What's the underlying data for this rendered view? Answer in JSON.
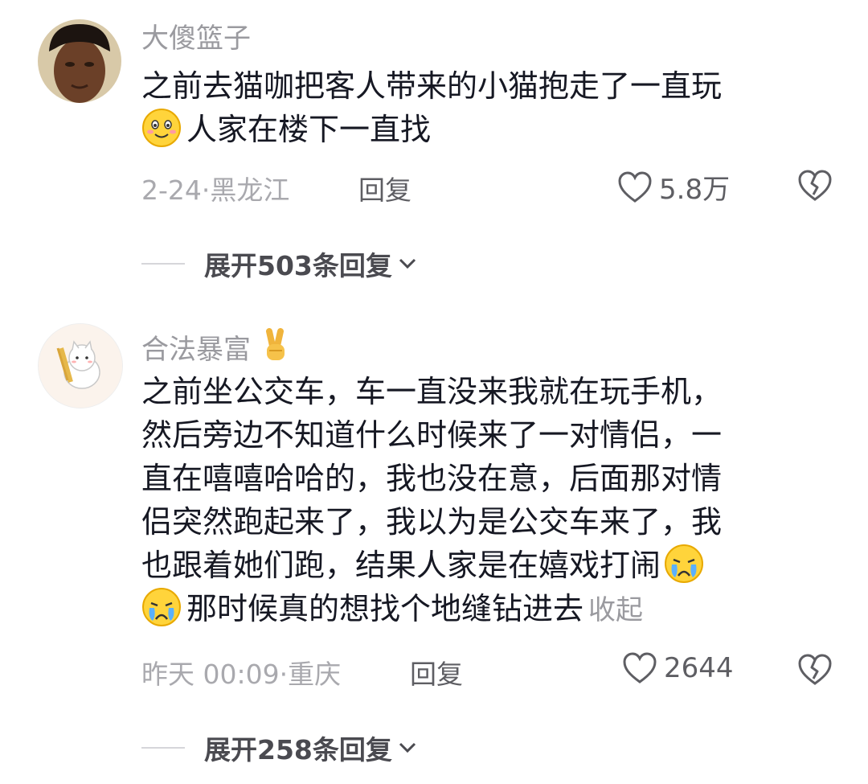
{
  "comments": [
    {
      "username": "大傻篮子",
      "lines": [
        "之前去猫咖把客人带来的小猫抱走了一直玩",
        "人家在楼下一直找"
      ],
      "date_location": "2-24·黑龙江",
      "reply_label": "回复",
      "likes": "5.8万",
      "expand_label": "展开503条回复"
    },
    {
      "username": "合法暴富",
      "username_emoji": "✌️",
      "lines": [
        "之前坐公交车，车一直没来我就在玩手机，",
        "然后旁边不知道什么时候来了一对情侣，一",
        "直在嘻嘻哈哈的，我也没在意，后面那对情",
        "侣突然跑起来了，我以为是公交车来了，我",
        "也跟着她们跑，结果人家是在嬉戏打闹",
        "那时候真的想找个地缝钻进去"
      ],
      "collapse_label": "收起",
      "date_location": "昨天 00:09·重庆",
      "reply_label": "回复",
      "likes": "2644",
      "expand_label": "展开258条回复"
    }
  ],
  "icons": {
    "like": "heart-outline-icon",
    "dislike": "broken-heart-icon",
    "expand": "chevron-down-icon",
    "emoji_smile": "smiling-face-emoji",
    "emoji_cry": "crying-face-emoji"
  },
  "colors": {
    "text": "#161823",
    "muted": "#9a9a9f",
    "action": "#5e5e63"
  }
}
